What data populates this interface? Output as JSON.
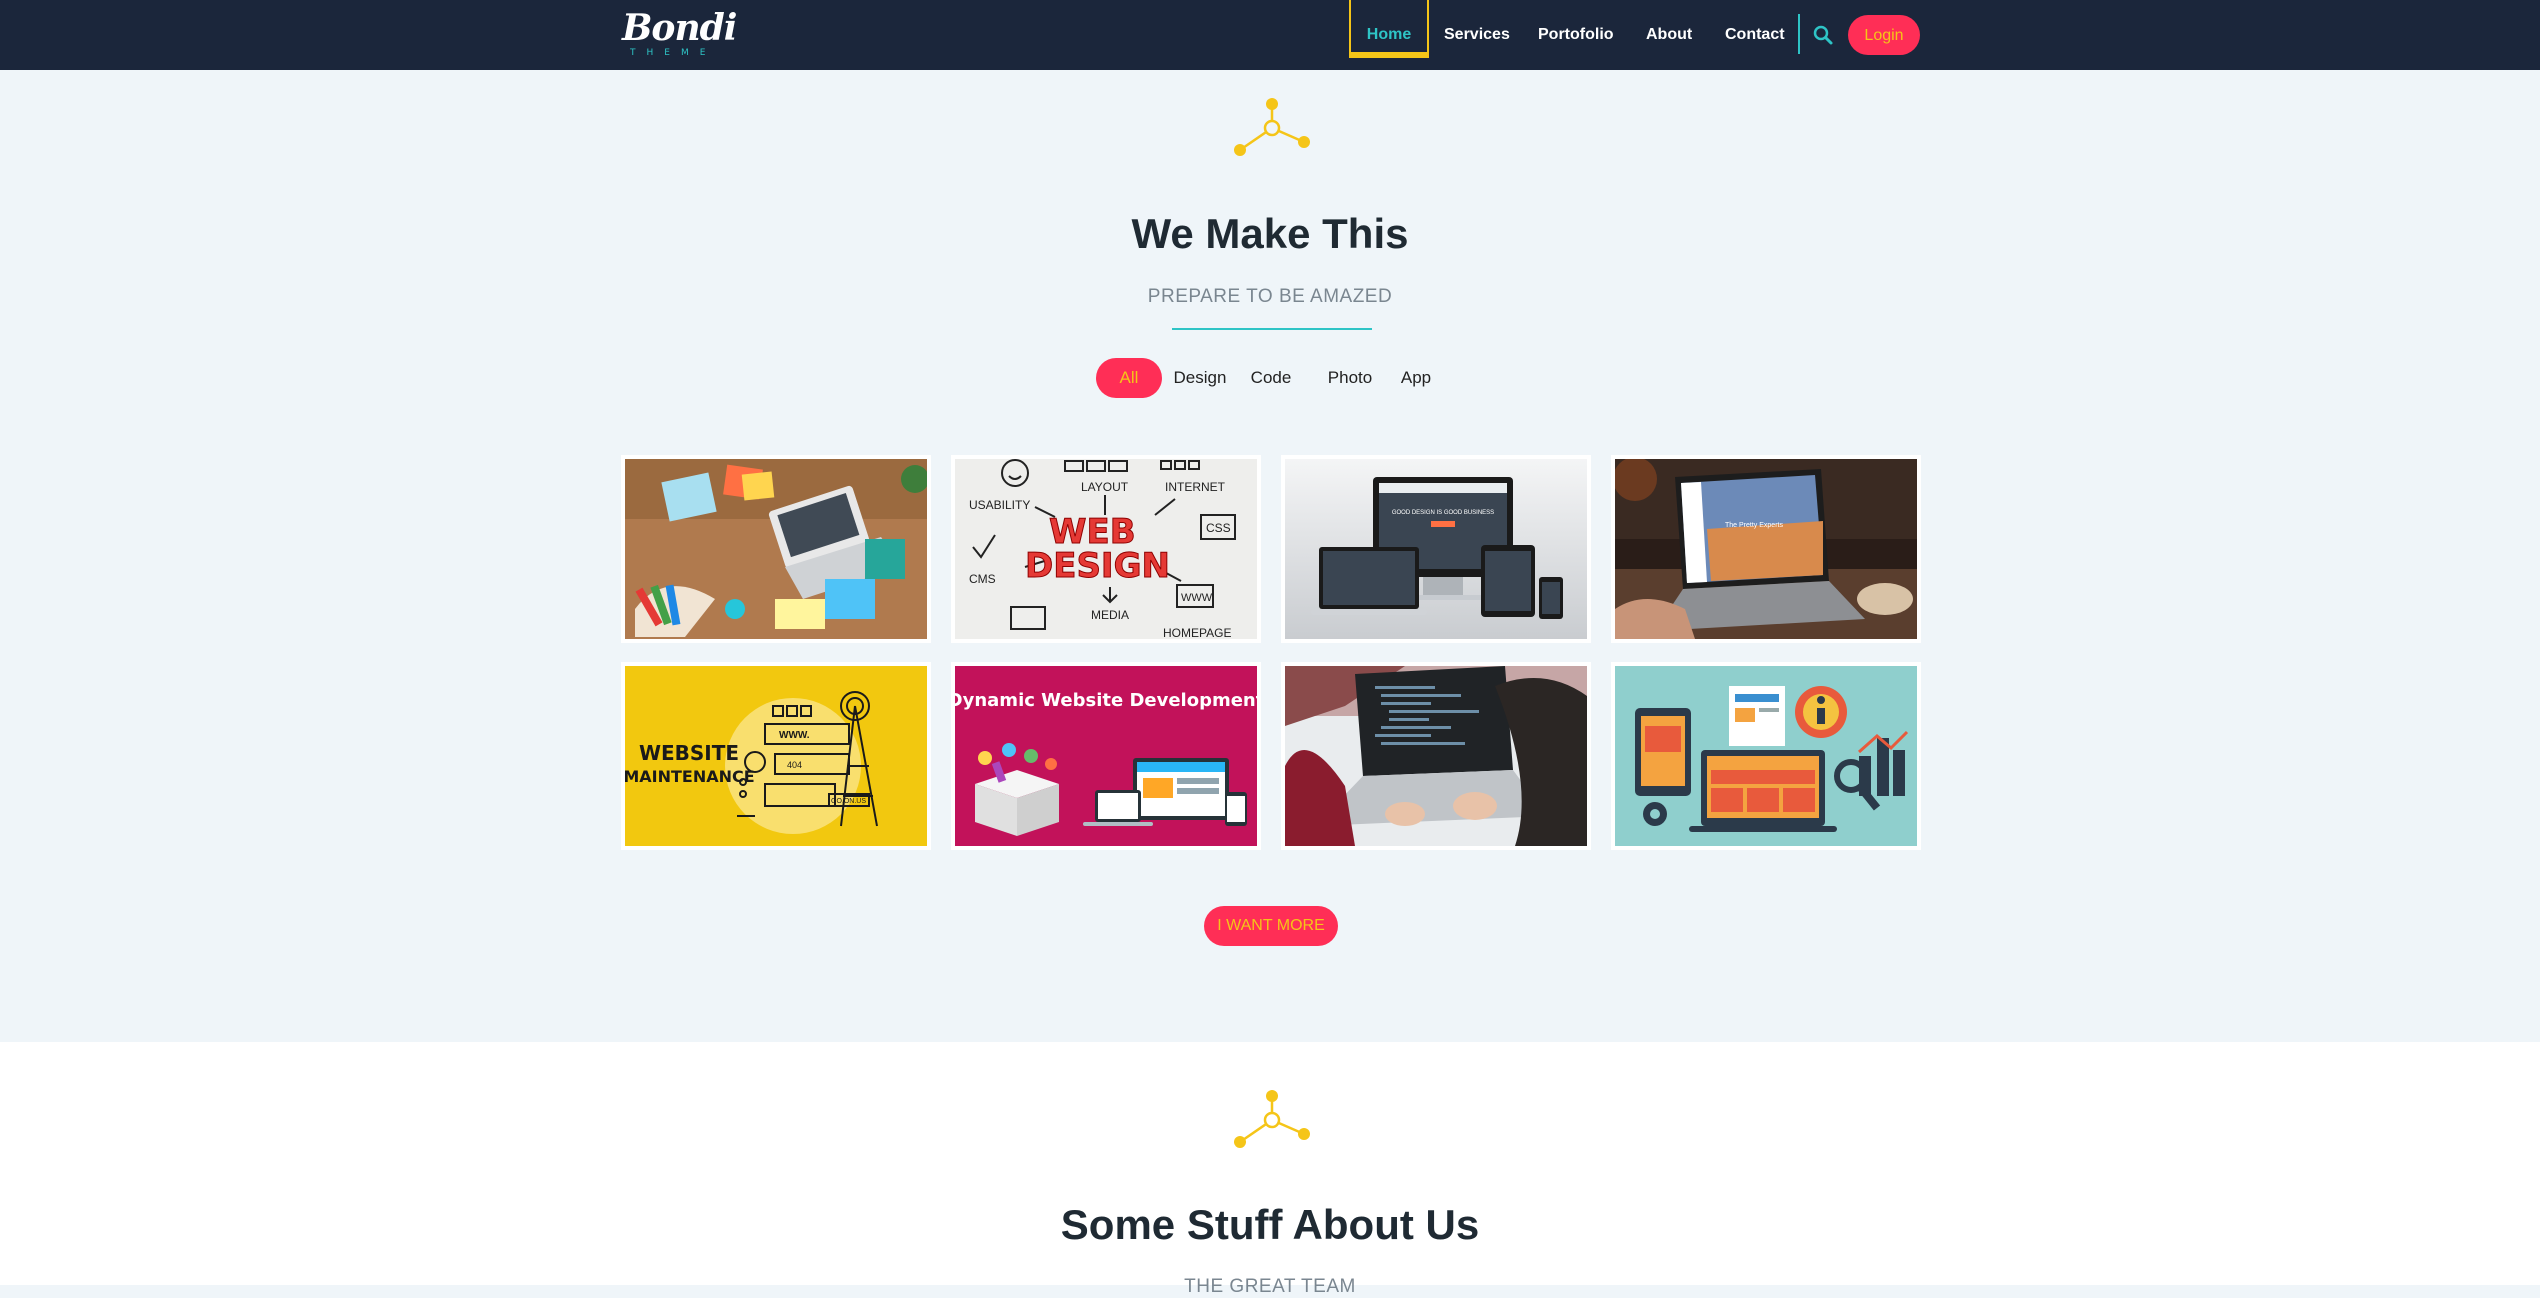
{
  "nav": {
    "brand_main": "Bondi",
    "brand_sub": "THEME",
    "items": [
      "Home",
      "Services",
      "Portofolio",
      "About",
      "Contact"
    ],
    "search_icon": "search-icon",
    "login_label": "Login"
  },
  "portfolio": {
    "title": "We Make This",
    "subtitle": "PREPARE TO BE AMAZED",
    "filters": [
      "All",
      "Design",
      "Code",
      "Photo",
      "App"
    ],
    "active_filter": "All",
    "tiles": [
      {
        "name": "laptop-desk-photo"
      },
      {
        "name": "web-design-sketch",
        "words": [
          "USABILITY",
          "LAYOUT",
          "INTERNET",
          "WEB",
          "DESIGN",
          "CSS",
          "CMS",
          "MEDIA",
          "WWW",
          "HOMEPAGE"
        ]
      },
      {
        "name": "responsive-devices-mockup",
        "screen_text": "GOOD DESIGN IS GOOD BUSINESS"
      },
      {
        "name": "laptop-website-photo",
        "screen_text": "The Pretty Experts"
      },
      {
        "name": "website-maintenance-illustration",
        "caption_lines": [
          "WEBSITE",
          "MAINTENANCE"
        ],
        "labels": [
          "WWW.",
          "404",
          "GO.ON.US"
        ]
      },
      {
        "name": "dynamic-website-development-illustration",
        "caption": "Dynamic Website Development"
      },
      {
        "name": "coding-laptop-photo"
      },
      {
        "name": "web-info-flat-illustration"
      }
    ],
    "more_label": "I WANT MORE"
  },
  "about": {
    "title": "Some Stuff About Us",
    "subtitle": "THE GREAT TEAM"
  },
  "colors": {
    "navbar": "#1b263b",
    "accent_red": "#ff2e56",
    "accent_yellow": "#f5c518",
    "accent_teal": "#2ec4c6",
    "page_bg": "#eff5f9"
  }
}
